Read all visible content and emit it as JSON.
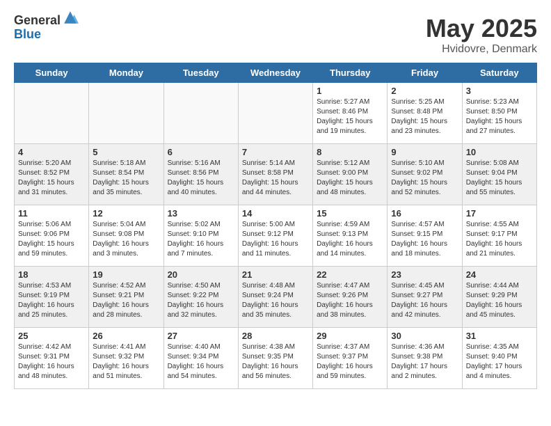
{
  "header": {
    "logo_general": "General",
    "logo_blue": "Blue",
    "title": "May 2025",
    "location": "Hvidovre, Denmark"
  },
  "days": [
    "Sunday",
    "Monday",
    "Tuesday",
    "Wednesday",
    "Thursday",
    "Friday",
    "Saturday"
  ],
  "weeks": [
    [
      {
        "day": "",
        "text": ""
      },
      {
        "day": "",
        "text": ""
      },
      {
        "day": "",
        "text": ""
      },
      {
        "day": "",
        "text": ""
      },
      {
        "day": "1",
        "text": "Sunrise: 5:27 AM\nSunset: 8:46 PM\nDaylight: 15 hours\nand 19 minutes."
      },
      {
        "day": "2",
        "text": "Sunrise: 5:25 AM\nSunset: 8:48 PM\nDaylight: 15 hours\nand 23 minutes."
      },
      {
        "day": "3",
        "text": "Sunrise: 5:23 AM\nSunset: 8:50 PM\nDaylight: 15 hours\nand 27 minutes."
      }
    ],
    [
      {
        "day": "4",
        "text": "Sunrise: 5:20 AM\nSunset: 8:52 PM\nDaylight: 15 hours\nand 31 minutes."
      },
      {
        "day": "5",
        "text": "Sunrise: 5:18 AM\nSunset: 8:54 PM\nDaylight: 15 hours\nand 35 minutes."
      },
      {
        "day": "6",
        "text": "Sunrise: 5:16 AM\nSunset: 8:56 PM\nDaylight: 15 hours\nand 40 minutes."
      },
      {
        "day": "7",
        "text": "Sunrise: 5:14 AM\nSunset: 8:58 PM\nDaylight: 15 hours\nand 44 minutes."
      },
      {
        "day": "8",
        "text": "Sunrise: 5:12 AM\nSunset: 9:00 PM\nDaylight: 15 hours\nand 48 minutes."
      },
      {
        "day": "9",
        "text": "Sunrise: 5:10 AM\nSunset: 9:02 PM\nDaylight: 15 hours\nand 52 minutes."
      },
      {
        "day": "10",
        "text": "Sunrise: 5:08 AM\nSunset: 9:04 PM\nDaylight: 15 hours\nand 55 minutes."
      }
    ],
    [
      {
        "day": "11",
        "text": "Sunrise: 5:06 AM\nSunset: 9:06 PM\nDaylight: 15 hours\nand 59 minutes."
      },
      {
        "day": "12",
        "text": "Sunrise: 5:04 AM\nSunset: 9:08 PM\nDaylight: 16 hours\nand 3 minutes."
      },
      {
        "day": "13",
        "text": "Sunrise: 5:02 AM\nSunset: 9:10 PM\nDaylight: 16 hours\nand 7 minutes."
      },
      {
        "day": "14",
        "text": "Sunrise: 5:00 AM\nSunset: 9:12 PM\nDaylight: 16 hours\nand 11 minutes."
      },
      {
        "day": "15",
        "text": "Sunrise: 4:59 AM\nSunset: 9:13 PM\nDaylight: 16 hours\nand 14 minutes."
      },
      {
        "day": "16",
        "text": "Sunrise: 4:57 AM\nSunset: 9:15 PM\nDaylight: 16 hours\nand 18 minutes."
      },
      {
        "day": "17",
        "text": "Sunrise: 4:55 AM\nSunset: 9:17 PM\nDaylight: 16 hours\nand 21 minutes."
      }
    ],
    [
      {
        "day": "18",
        "text": "Sunrise: 4:53 AM\nSunset: 9:19 PM\nDaylight: 16 hours\nand 25 minutes."
      },
      {
        "day": "19",
        "text": "Sunrise: 4:52 AM\nSunset: 9:21 PM\nDaylight: 16 hours\nand 28 minutes."
      },
      {
        "day": "20",
        "text": "Sunrise: 4:50 AM\nSunset: 9:22 PM\nDaylight: 16 hours\nand 32 minutes."
      },
      {
        "day": "21",
        "text": "Sunrise: 4:48 AM\nSunset: 9:24 PM\nDaylight: 16 hours\nand 35 minutes."
      },
      {
        "day": "22",
        "text": "Sunrise: 4:47 AM\nSunset: 9:26 PM\nDaylight: 16 hours\nand 38 minutes."
      },
      {
        "day": "23",
        "text": "Sunrise: 4:45 AM\nSunset: 9:27 PM\nDaylight: 16 hours\nand 42 minutes."
      },
      {
        "day": "24",
        "text": "Sunrise: 4:44 AM\nSunset: 9:29 PM\nDaylight: 16 hours\nand 45 minutes."
      }
    ],
    [
      {
        "day": "25",
        "text": "Sunrise: 4:42 AM\nSunset: 9:31 PM\nDaylight: 16 hours\nand 48 minutes."
      },
      {
        "day": "26",
        "text": "Sunrise: 4:41 AM\nSunset: 9:32 PM\nDaylight: 16 hours\nand 51 minutes."
      },
      {
        "day": "27",
        "text": "Sunrise: 4:40 AM\nSunset: 9:34 PM\nDaylight: 16 hours\nand 54 minutes."
      },
      {
        "day": "28",
        "text": "Sunrise: 4:38 AM\nSunset: 9:35 PM\nDaylight: 16 hours\nand 56 minutes."
      },
      {
        "day": "29",
        "text": "Sunrise: 4:37 AM\nSunset: 9:37 PM\nDaylight: 16 hours\nand 59 minutes."
      },
      {
        "day": "30",
        "text": "Sunrise: 4:36 AM\nSunset: 9:38 PM\nDaylight: 17 hours\nand 2 minutes."
      },
      {
        "day": "31",
        "text": "Sunrise: 4:35 AM\nSunset: 9:40 PM\nDaylight: 17 hours\nand 4 minutes."
      }
    ]
  ]
}
